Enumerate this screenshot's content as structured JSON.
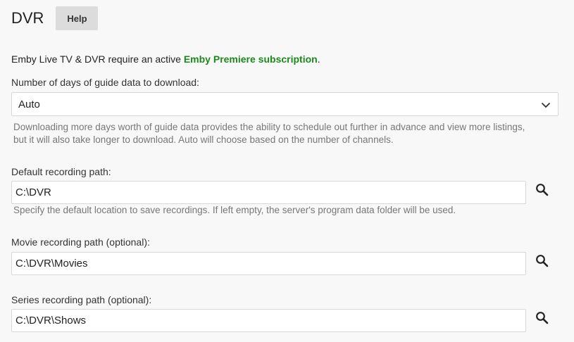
{
  "header": {
    "title": "DVR",
    "help_label": "Help"
  },
  "notice": {
    "prefix": "Emby Live TV & DVR require an active ",
    "link_text": "Emby Premiere subscription",
    "suffix": "."
  },
  "guide_days": {
    "label": "Number of days of guide data to download:",
    "selected": "Auto",
    "help_line1": "Downloading more days worth of guide data provides the ability to schedule out further in advance and view more listings,",
    "help_line2": "but it will also take longer to download. Auto will choose based on the number of channels."
  },
  "default_path": {
    "label": "Default recording path:",
    "value": "C:\\DVR",
    "help": "Specify the default location to save recordings. If left empty, the server's program data folder will be used."
  },
  "movie_path": {
    "label": "Movie recording path (optional):",
    "value": "C:\\DVR\\Movies"
  },
  "series_path": {
    "label": "Series recording path (optional):",
    "value": "C:\\DVR\\Shows"
  },
  "icons": {
    "chevron": "chevron-down-icon",
    "search": "search-icon"
  },
  "colors": {
    "premiere_link": "#1a8a1a",
    "help_button_bg": "#dcdcdc",
    "page_bg": "#f8f8f8"
  }
}
